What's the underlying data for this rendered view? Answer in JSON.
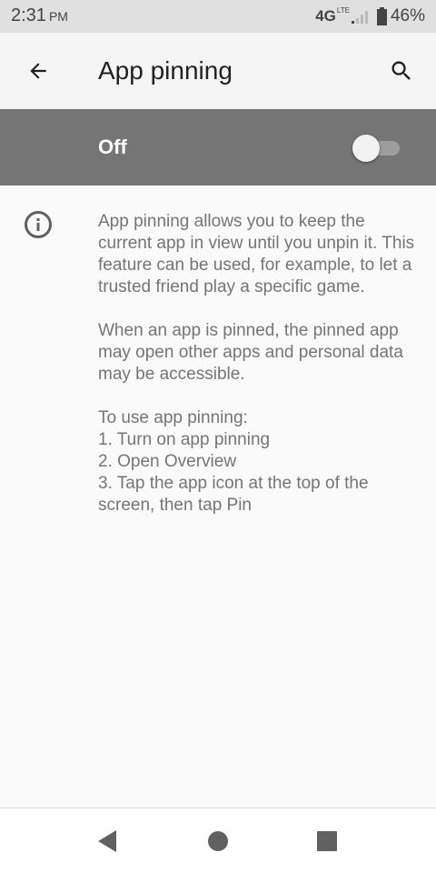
{
  "status_bar": {
    "time": "2:31",
    "ampm": "PM",
    "network": "4G",
    "network_sub": "LTE",
    "battery": "46%"
  },
  "header": {
    "title": "App pinning",
    "back_icon": "arrow-back-icon",
    "search_icon": "search-icon"
  },
  "master_switch": {
    "label": "Off",
    "checked": false
  },
  "content": {
    "icon": "info-icon",
    "paragraph1": "App pinning allows you to keep the current app in view until you unpin it. This feature can be used, for example, to let a trusted friend play a specific game.",
    "paragraph2": "When an app is pinned, the pinned app may open other apps and personal data may be accessible.",
    "steps_intro": "To use app pinning:",
    "steps": [
      "1. Turn on app pinning",
      "2. Open Overview",
      "3. Tap the app icon at the top of the screen, then tap Pin"
    ]
  },
  "nav_bar": {
    "back": "back-triangle-icon",
    "home": "home-circle-icon",
    "recents": "recents-square-icon"
  }
}
